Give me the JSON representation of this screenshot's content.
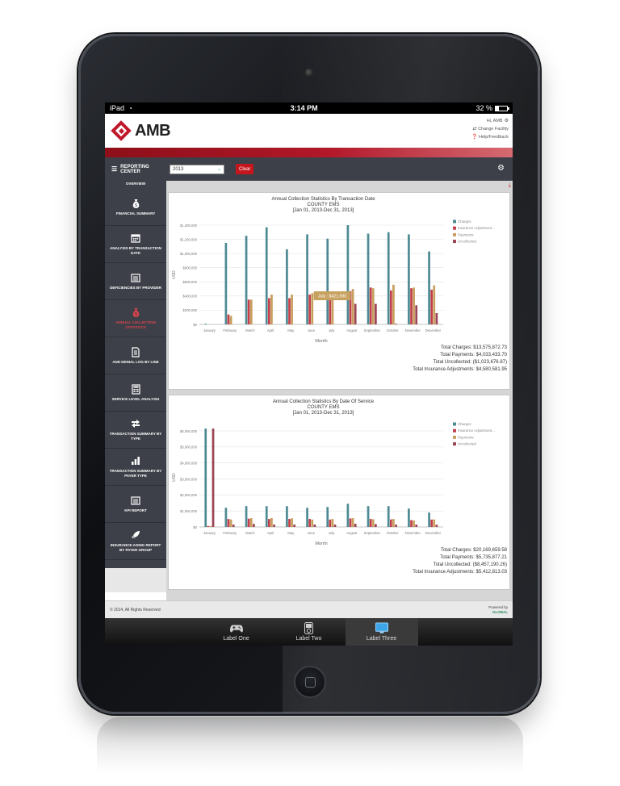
{
  "status_bar": {
    "carrier": "iPad",
    "time": "3:14 PM",
    "battery": "32 %"
  },
  "header": {
    "logo_text": "AMB",
    "greeting": "Hi, AMB",
    "change_facility": "Change Facility",
    "help": "Help/Feedback"
  },
  "toolbar": {
    "reporting_center": "REPORTING CENTER",
    "year": "2013",
    "clear_label": "Clear"
  },
  "sidebar": {
    "overview": "OVERVIEW",
    "items": [
      {
        "label": "FINANCIAL SUMMARY",
        "icon": "money-bag-icon"
      },
      {
        "label": "ANALYSIS BY TRANSACTION DATE",
        "icon": "calendar-icon"
      },
      {
        "label": "DEFICIENCIES BY PROVIDER",
        "icon": "list-box-icon"
      },
      {
        "label": "ANNUAL COLLECTION STATISTICS",
        "icon": "money-bag-icon"
      },
      {
        "label": "AND DENIAL LOG BY LINE",
        "icon": "document-icon"
      },
      {
        "label": "SERVICE LEVEL ANALYSIS",
        "icon": "calculator-icon"
      },
      {
        "label": "TRANSACTION SUMMARY BY TYPE",
        "icon": "arrows-icon"
      },
      {
        "label": "TRANSACTION SUMMARY BY PAYER TYPE",
        "icon": "bar-chart-icon"
      },
      {
        "label": "KPI REPORT",
        "icon": "list-box-icon"
      },
      {
        "label": "INSURANCE AGING REPORT BY PAYER GROUP",
        "icon": "rocket-icon"
      }
    ]
  },
  "colors": {
    "charges": "#4e8a93",
    "insurance": "#c2404b",
    "payments": "#c89e5d",
    "uncollected": "#9a4454"
  },
  "chart_data": [
    {
      "type": "bar",
      "title": "Annual Collection Statistics By Transaction Date",
      "subtitle1": "COUNTY EMS",
      "subtitle2": "[Jan 01, 2013-Dec 31, 2013]",
      "xlabel": "Month",
      "ylabel": "USD",
      "ylim": [
        0,
        1400000
      ],
      "yticks": [
        0,
        200000,
        400000,
        600000,
        800000,
        1000000,
        1200000,
        1400000
      ],
      "ytick_labels": [
        "$0",
        "$200,000",
        "$400,000",
        "$600,000",
        "$800,000",
        "$1,000,000",
        "$1,200,000",
        "$1,400,000"
      ],
      "categories": [
        "January",
        "February",
        "March",
        "April",
        "May",
        "June",
        "July",
        "August",
        "September",
        "October",
        "November",
        "December"
      ],
      "series": [
        {
          "name": "Charges",
          "values": [
            10000,
            1150000,
            1250000,
            1370000,
            1060000,
            1270000,
            1210000,
            1400000,
            1280000,
            1300000,
            1270000,
            1030000
          ]
        },
        {
          "name": "Insurance Adjustment...",
          "values": [
            0,
            140000,
            350000,
            370000,
            370000,
            420000,
            380000,
            470000,
            520000,
            480000,
            510000,
            490000
          ]
        },
        {
          "name": "Payments",
          "values": [
            0,
            120000,
            350000,
            420000,
            420000,
            440000,
            421690,
            500000,
            510000,
            560000,
            520000,
            550000
          ]
        },
        {
          "name": "Uncollected",
          "values": [
            0,
            0,
            0,
            0,
            0,
            0,
            0,
            290000,
            290000,
            10000,
            270000,
            160000
          ]
        }
      ],
      "legend_position": "top-right",
      "tooltip": "July : $421,690",
      "totals": [
        "Total Charges: $13,575,872.73",
        "Total Payments: $4,033,433.70",
        "Total Uncollected: ($1,023,676.87)",
        "Total Insurance Adjustments: $4,580,581.95"
      ]
    },
    {
      "type": "bar",
      "title": "Annual Collection Statistics By Date Of Service",
      "subtitle1": "COUNTY EMS",
      "subtitle2": "[Jan 01, 2013-Dec 31, 2013]",
      "xlabel": "Month",
      "ylabel": "USD",
      "ylim": [
        0,
        6200000
      ],
      "yticks": [
        0,
        1000000,
        2000000,
        3000000,
        4000000,
        5000000,
        6000000
      ],
      "ytick_labels": [
        "$0",
        "$1,000,000",
        "$2,000,000",
        "$3,000,000",
        "$4,000,000",
        "$5,000,000",
        "$6,000,000"
      ],
      "categories": [
        "January",
        "February",
        "March",
        "April",
        "May",
        "June",
        "July",
        "August",
        "September",
        "October",
        "November",
        "December"
      ],
      "series": [
        {
          "name": "Charges",
          "values": [
            6150000,
            1200000,
            1300000,
            1300000,
            1300000,
            1200000,
            1250000,
            1450000,
            1300000,
            1300000,
            1150000,
            900000
          ]
        },
        {
          "name": "Insurance Adjustment...",
          "values": [
            60000,
            500000,
            520000,
            500000,
            500000,
            500000,
            460000,
            530000,
            500000,
            470000,
            430000,
            460000
          ]
        },
        {
          "name": "Payments",
          "values": [
            60000,
            470000,
            550000,
            560000,
            540000,
            460000,
            500000,
            550000,
            480000,
            500000,
            400000,
            470000
          ]
        },
        {
          "name": "Uncollected",
          "values": [
            6150000,
            150000,
            190000,
            150000,
            150000,
            150000,
            150000,
            200000,
            180000,
            150000,
            150000,
            140000
          ]
        }
      ],
      "legend_position": "top-right",
      "totals": [
        "Total Charges: $20,169,659.58",
        "Total Payments: $5,735,877.21",
        "Total Uncollected: ($8,457,190.26)",
        "Total Insurance Adjustments: $5,412,813.03"
      ]
    }
  ],
  "footer": {
    "copyright": "© 2014, All Rights Reserved",
    "powered_by": "Powered by",
    "brand": "GLOBAL"
  },
  "tabs": [
    {
      "label": "Label One",
      "icon": "gamepad-icon"
    },
    {
      "label": "Label Two",
      "icon": "ipod-icon"
    },
    {
      "label": "Label Three",
      "icon": "monitor-icon"
    }
  ]
}
